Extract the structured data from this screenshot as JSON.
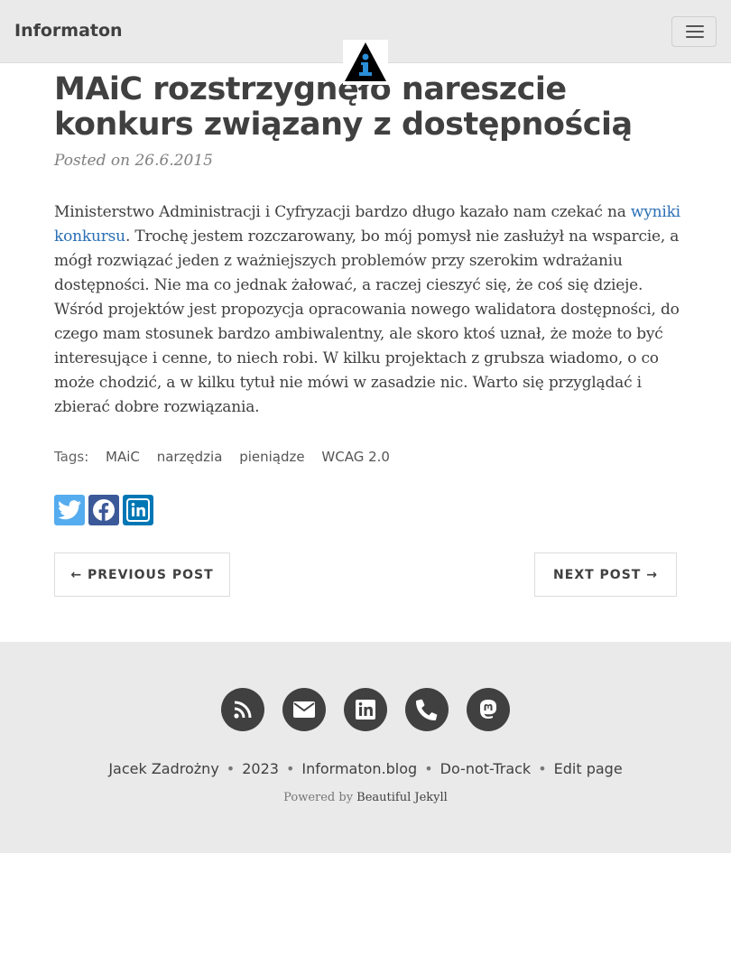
{
  "nav": {
    "brand": "Informaton",
    "menu_toggle_label": "Toggle navigation"
  },
  "post": {
    "title": "MAiC rozstrzygnęło nareszcie konkurs związany z dostępnością",
    "meta": "Posted on 26.6.2015",
    "body_before_link": "Ministerstwo Administracji i Cyfryzacji bardzo długo kazało nam czekać na ",
    "body_link": "wyniki konkursu",
    "body_after_link": ". Trochę jestem rozczarowany, bo mój pomysł nie zasłużył na wsparcie, a mógł rozwiązać jeden z ważniejszych problemów przy szerokim wdrażaniu dostępności. Nie ma co jednak żałować, a raczej cieszyć się, że coś się dzieje. Wśród projektów jest propozycja opracowania nowego walidatora dostępności, do czego mam stosunek bardzo ambiwalentny, ale skoro ktoś uznał, że może to być interesujące i cenne, to niech robi. W kilku projektach z grubsza wiadomo, o co może chodzić, a w kilku tytuł nie mówi w zasadzie nic. Warto się przyglądać i zbierać dobre rozwiązania."
  },
  "tags": {
    "label": "Tags:",
    "items": [
      "MAiC",
      "narzędzia",
      "pieniądze",
      "WCAG 2.0"
    ]
  },
  "share": {
    "icons": [
      "twitter-icon",
      "facebook-icon",
      "linkedin-icon"
    ]
  },
  "pager": {
    "previous": "← PREVIOUS POST",
    "next": "NEXT POST →"
  },
  "footer": {
    "icons": [
      "rss-icon",
      "envelope-icon",
      "linkedin-icon",
      "phone-icon",
      "mastodon-icon"
    ],
    "author": "Jacek Zadrożny",
    "year": "2023",
    "site": "Informaton.blog",
    "dnt": "Do-not-Track",
    "edit": "Edit page",
    "powered_prefix": "Powered by ",
    "powered_link": "Beautiful Jekyll",
    "separator": "•"
  },
  "colors": {
    "link": "#2a6fb6",
    "navbar_bg": "#eaeaea",
    "text": "#404040",
    "twitter": "#55acee",
    "facebook": "#3b5998",
    "linkedin": "#0077b5"
  }
}
